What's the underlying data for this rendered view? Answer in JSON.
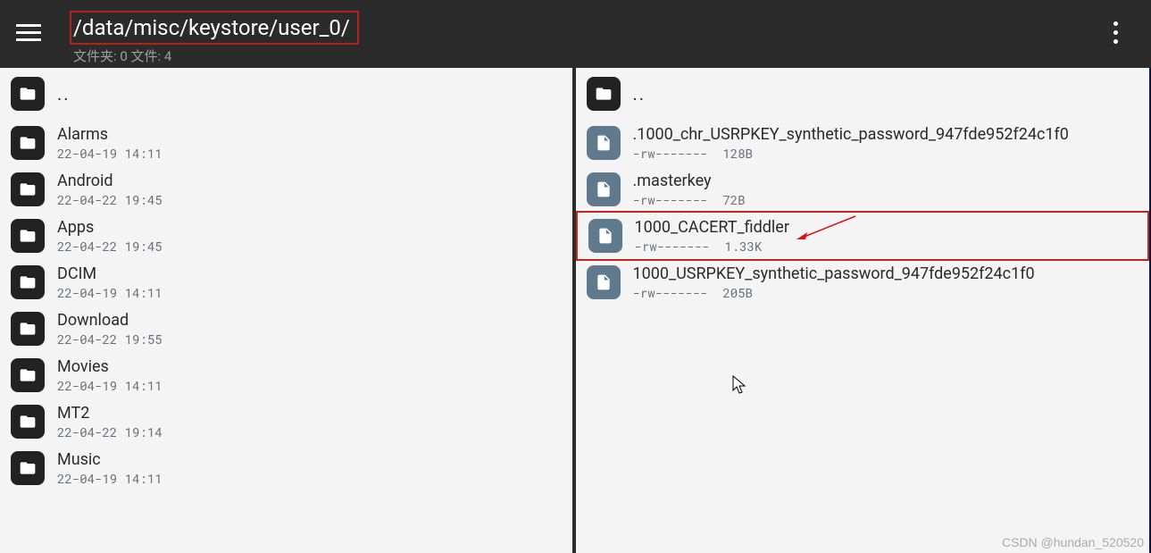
{
  "header": {
    "path": "/data/misc/keystore/user_0/",
    "subtitle": "文件夹: 0  文件: 4"
  },
  "panes": {
    "left": {
      "up_label": "..",
      "items": [
        {
          "name": "Alarms",
          "meta": "22-04-19 14:11"
        },
        {
          "name": "Android",
          "meta": "22-04-22 19:45"
        },
        {
          "name": "Apps",
          "meta": "22-04-22 19:45"
        },
        {
          "name": "DCIM",
          "meta": "22-04-19 14:11"
        },
        {
          "name": "Download",
          "meta": "22-04-22 19:55"
        },
        {
          "name": "Movies",
          "meta": "22-04-19 14:11"
        },
        {
          "name": "MT2",
          "meta": "22-04-22 19:14"
        },
        {
          "name": "Music",
          "meta": "22-04-19 14:11"
        }
      ]
    },
    "right": {
      "up_label": "..",
      "items": [
        {
          "name": ".1000_chr_USRPKEY_synthetic_password_947fde952f24c1f0",
          "perm": "-rw-------",
          "size": "128B",
          "highlight": false
        },
        {
          "name": ".masterkey",
          "perm": "-rw-------",
          "size": "72B",
          "highlight": false
        },
        {
          "name": "1000_CACERT_fiddler",
          "perm": "-rw-------",
          "size": "1.33K",
          "highlight": true
        },
        {
          "name": "1000_USRPKEY_synthetic_password_947fde952f24c1f0",
          "perm": "-rw-------",
          "size": "205B",
          "highlight": false
        }
      ]
    }
  },
  "watermark": "CSDN @hundan_520520"
}
